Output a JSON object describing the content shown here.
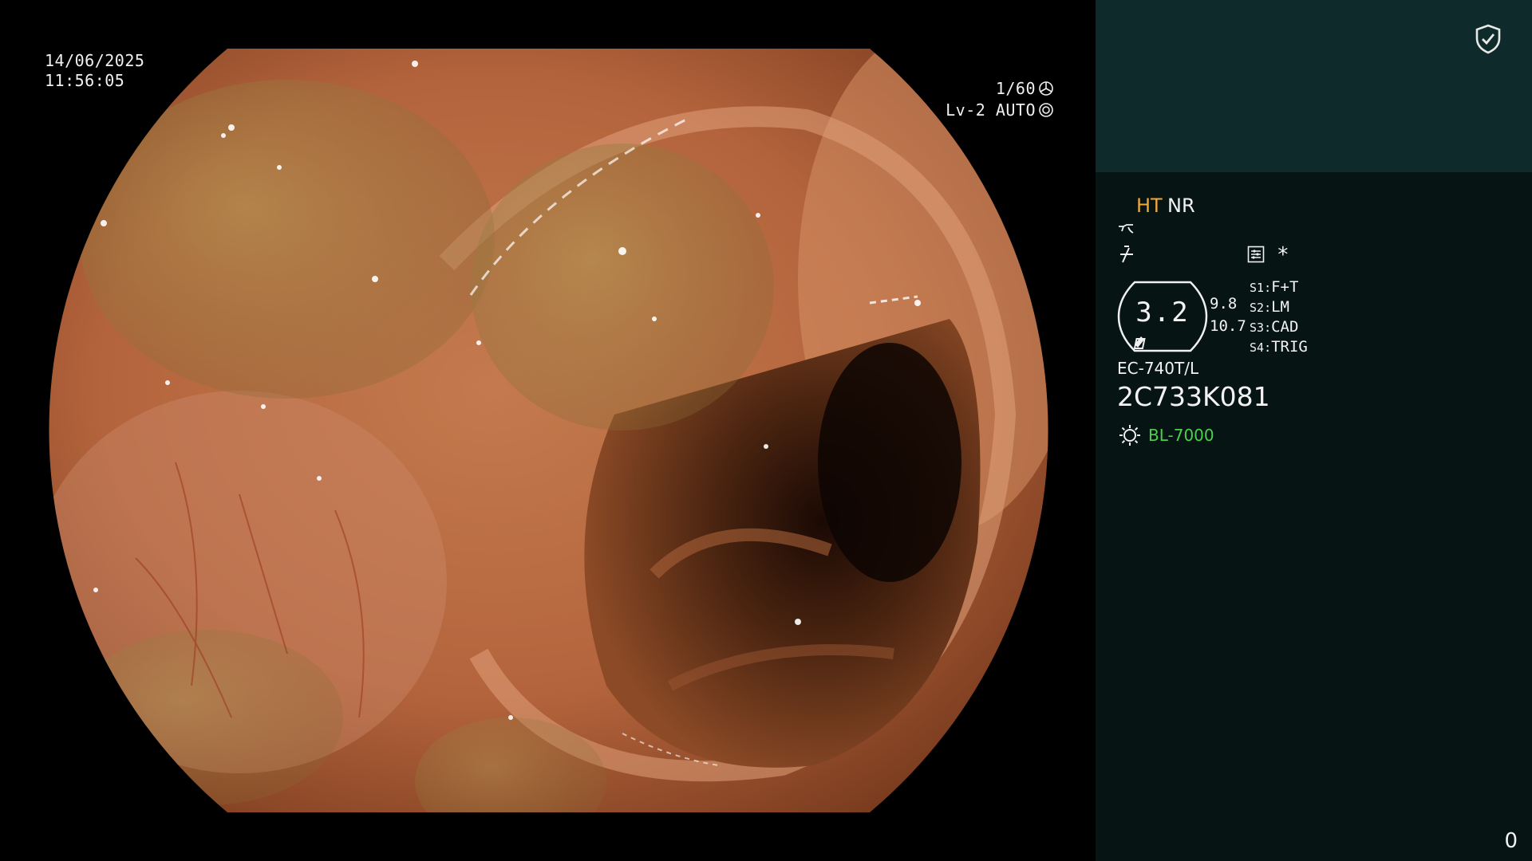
{
  "osd": {
    "date": "14/06/2025",
    "time": "11:56:05",
    "shutter": "1/60",
    "level": "Lv-2 AUTO"
  },
  "panel": {
    "mode_ht": "HT",
    "mode_nr": "NR",
    "asterisk": "*",
    "zoom_value": "3.2",
    "sub_value_a": "9.8",
    "sub_value_b": "10.7",
    "switches": [
      {
        "key": "S1",
        "value": "F+T"
      },
      {
        "key": "S2",
        "value": "LM"
      },
      {
        "key": "S3",
        "value": "CAD"
      },
      {
        "key": "S4",
        "value": "TRIG"
      }
    ],
    "scope_model": "EC-740T/L",
    "scope_serial": "2C733K081",
    "light_source": "BL-7000",
    "counter": "0"
  },
  "colors": {
    "panel_top": "#0e2a2a",
    "panel_bg": "#071414",
    "ht_accent": "#f0a83a",
    "light_source_green": "#4ccf4c"
  },
  "icons": [
    "shield-check-icon",
    "gamma-curve-icon",
    "filter-icon",
    "settings-list-icon",
    "light-source-icon",
    "shutter-icon",
    "iris-icon"
  ]
}
